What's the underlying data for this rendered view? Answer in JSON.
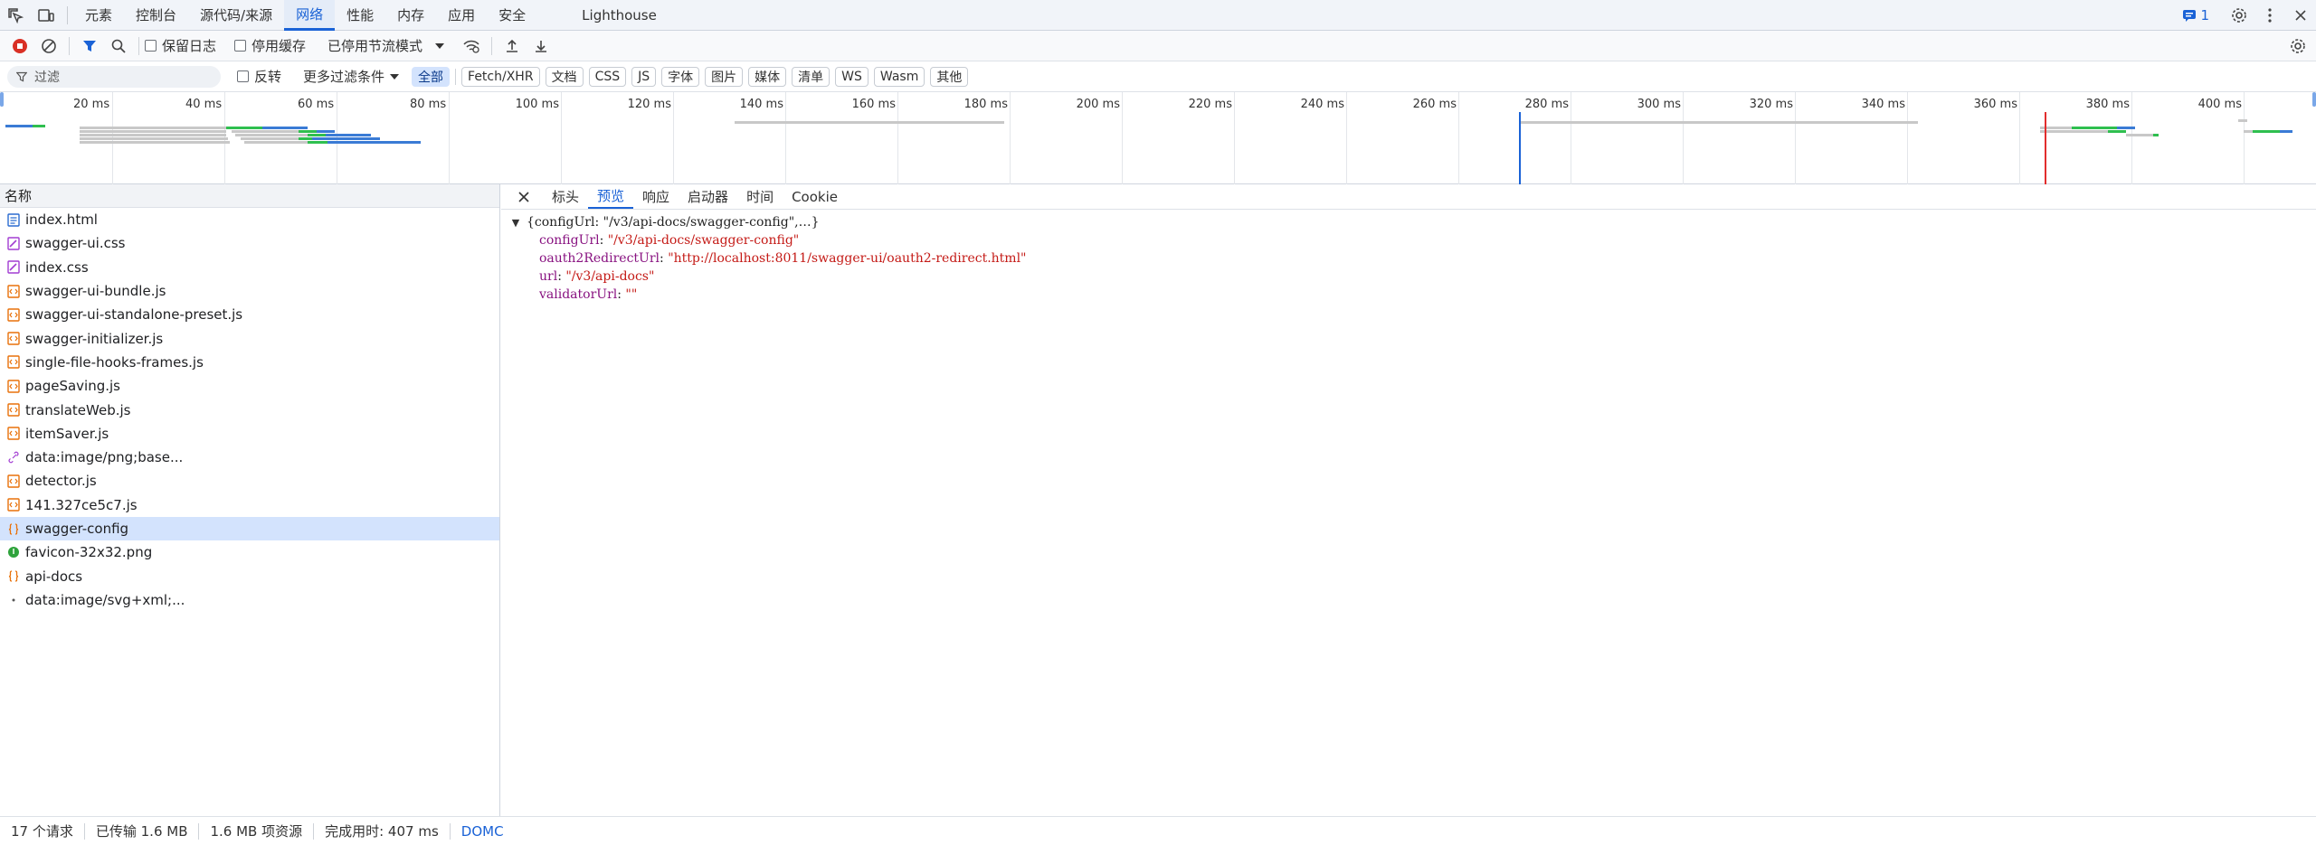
{
  "main_tabs": [
    "元素",
    "控制台",
    "源代码/来源",
    "网络",
    "性能",
    "内存",
    "应用",
    "安全",
    "Lighthouse"
  ],
  "active_main_tab": "网络",
  "message_count": "1",
  "toolbar": {
    "preserve_log": "保留日志",
    "disable_cache": "停用缓存",
    "throttling": "已停用节流模式"
  },
  "filter": {
    "placeholder": "过滤",
    "invert": "反转",
    "more_filters": "更多过滤条件",
    "types": [
      "全部",
      "Fetch/XHR",
      "文档",
      "CSS",
      "JS",
      "字体",
      "图片",
      "媒体",
      "清单",
      "WS",
      "Wasm",
      "其他"
    ],
    "active_type": "全部"
  },
  "timeline": {
    "ticks": [
      "20 ms",
      "40 ms",
      "60 ms",
      "80 ms",
      "100 ms",
      "120 ms",
      "140 ms",
      "160 ms",
      "180 ms",
      "200 ms",
      "220 ms",
      "240 ms",
      "260 ms",
      "280 ms",
      "300 ms",
      "320 ms",
      "340 ms",
      "360 ms",
      "380 ms",
      "400 ms"
    ],
    "colors": {
      "waiting": "#3a7bd5",
      "receiving": "#2fbf4f",
      "queue": "#c8c8c8",
      "dom_line": "#1a62d6",
      "load_line": "#e22d2d"
    }
  },
  "list": {
    "column_name": "名称",
    "requests": [
      {
        "name": "index.html",
        "icon": "document-icon",
        "color": "#2b6cd1"
      },
      {
        "name": "swagger-ui.css",
        "icon": "stylesheet-icon",
        "color": "#a23dd2"
      },
      {
        "name": "index.css",
        "icon": "stylesheet-icon",
        "color": "#a23dd2"
      },
      {
        "name": "swagger-ui-bundle.js",
        "icon": "script-icon",
        "color": "#e8710a"
      },
      {
        "name": "swagger-ui-standalone-preset.js",
        "icon": "script-icon",
        "color": "#e8710a"
      },
      {
        "name": "swagger-initializer.js",
        "icon": "script-icon",
        "color": "#e8710a"
      },
      {
        "name": "single-file-hooks-frames.js",
        "icon": "script-icon",
        "color": "#e8710a"
      },
      {
        "name": "pageSaving.js",
        "icon": "script-icon",
        "color": "#e8710a"
      },
      {
        "name": "translateWeb.js",
        "icon": "script-icon",
        "color": "#e8710a"
      },
      {
        "name": "itemSaver.js",
        "icon": "script-icon",
        "color": "#e8710a"
      },
      {
        "name": "data:image/png;base...",
        "icon": "link-icon",
        "color": "#a23dd2"
      },
      {
        "name": "detector.js",
        "icon": "script-icon",
        "color": "#e8710a"
      },
      {
        "name": "141.327ce5c7.js",
        "icon": "script-icon",
        "color": "#e8710a"
      },
      {
        "name": "swagger-config",
        "icon": "json-icon",
        "color": "#e8710a"
      },
      {
        "name": "favicon-32x32.png",
        "icon": "image-icon",
        "color": "#2fa33c"
      },
      {
        "name": "api-docs",
        "icon": "json-icon",
        "color": "#e8710a"
      },
      {
        "name": "data:image/svg+xml;...",
        "icon": "dot-icon",
        "color": "#555555"
      }
    ],
    "selected": "swagger-config"
  },
  "detail": {
    "tabs": [
      "标头",
      "预览",
      "响应",
      "启动器",
      "时间",
      "Cookie"
    ],
    "active_tab": "预览",
    "preview": {
      "summary": "{configUrl: \"/v3/api-docs/swagger-config\",…}",
      "entries": [
        {
          "key": "configUrl",
          "value": "\"/v3/api-docs/swagger-config\""
        },
        {
          "key": "oauth2RedirectUrl",
          "value": "\"http://localhost:8011/swagger-ui/oauth2-redirect.html\""
        },
        {
          "key": "url",
          "value": "\"/v3/api-docs\""
        },
        {
          "key": "validatorUrl",
          "value": "\"\""
        }
      ]
    }
  },
  "status": {
    "requests": "17 个请求",
    "transferred": "已传输 1.6 MB",
    "resources": "1.6 MB 项资源",
    "finish": "完成用时: 407 ms",
    "domc": "DOMC"
  }
}
